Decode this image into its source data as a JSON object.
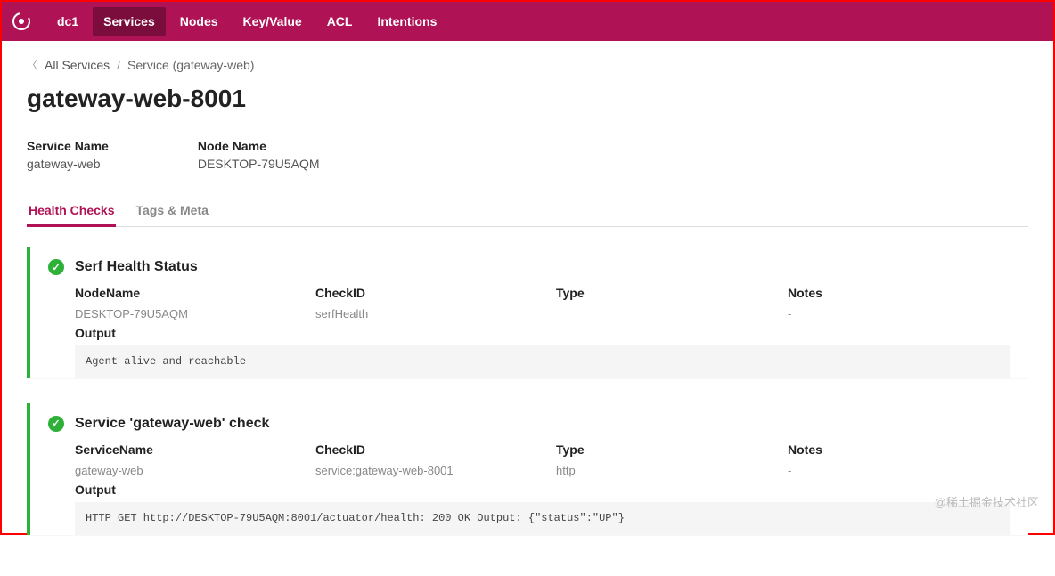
{
  "nav": {
    "dc": "dc1",
    "items": [
      "Services",
      "Nodes",
      "Key/Value",
      "ACL",
      "Intentions"
    ],
    "activeIndex": 0
  },
  "breadcrumb": {
    "back": "All Services",
    "current": "Service (gateway-web)"
  },
  "title": "gateway-web-8001",
  "meta": {
    "serviceNameLabel": "Service Name",
    "serviceName": "gateway-web",
    "nodeNameLabel": "Node Name",
    "nodeName": "DESKTOP-79U5AQM"
  },
  "tabs": {
    "items": [
      "Health Checks",
      "Tags & Meta"
    ],
    "activeIndex": 0
  },
  "labels": {
    "nodeName": "NodeName",
    "serviceName": "ServiceName",
    "checkId": "CheckID",
    "type": "Type",
    "notes": "Notes",
    "output": "Output"
  },
  "checks": [
    {
      "title": "Serf Health Status",
      "fields": {
        "NodeName": "DESKTOP-79U5AQM",
        "CheckID": "serfHealth",
        "Type": "",
        "Notes": "-"
      },
      "output": "Agent alive and reachable"
    },
    {
      "title": "Service 'gateway-web' check",
      "fields": {
        "ServiceName": "gateway-web",
        "CheckID": "service:gateway-web-8001",
        "Type": "http",
        "Notes": "-"
      },
      "output": "HTTP GET http://DESKTOP-79U5AQM:8001/actuator/health: 200 OK Output: {\"status\":\"UP\"}"
    }
  ],
  "watermark": "@稀土掘金技术社区"
}
